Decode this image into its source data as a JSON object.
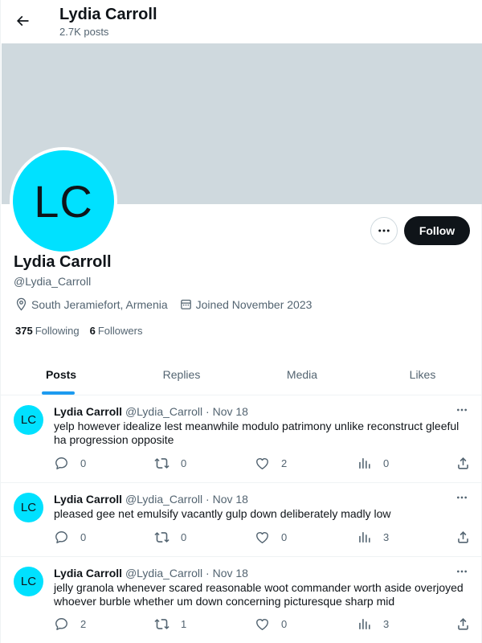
{
  "colors": {
    "banner": "#cfd9de",
    "avatar": "#00e1ff",
    "accent": "#1d9bf0",
    "follow_bg": "#0f1419"
  },
  "header": {
    "title": "Lydia Carroll",
    "subtitle": "2.7K posts",
    "back_icon": "arrow-left-icon"
  },
  "profile": {
    "initials": "LC",
    "name": "Lydia Carroll",
    "handle": "@Lydia_Carroll",
    "location": "South Jeramiefort, Armenia",
    "joined": "Joined November 2023",
    "following_count": "375",
    "following_label": "Following",
    "followers_count": "6",
    "followers_label": "Followers",
    "follow_button": "Follow"
  },
  "tabs": [
    {
      "label": "Posts",
      "active": true
    },
    {
      "label": "Replies",
      "active": false
    },
    {
      "label": "Media",
      "active": false
    },
    {
      "label": "Likes",
      "active": false
    }
  ],
  "posts": [
    {
      "initials": "LC",
      "name": "Lydia Carroll",
      "handle": "@Lydia_Carroll",
      "dot": "·",
      "date": "Nov 18",
      "text": "yelp however idealize lest meanwhile modulo patrimony unlike reconstruct gleeful ha progression opposite",
      "replies": "0",
      "reposts": "0",
      "likes": "2",
      "views": "0"
    },
    {
      "initials": "LC",
      "name": "Lydia Carroll",
      "handle": "@Lydia_Carroll",
      "dot": "·",
      "date": "Nov 18",
      "text": "pleased gee net emulsify vacantly gulp down deliberately madly low",
      "replies": "0",
      "reposts": "0",
      "likes": "0",
      "views": "3"
    },
    {
      "initials": "LC",
      "name": "Lydia Carroll",
      "handle": "@Lydia_Carroll",
      "dot": "·",
      "date": "Nov 18",
      "text": "jelly granola whenever scared reasonable woot commander worth aside overjoyed whoever burble whether um down concerning picturesque sharp mid",
      "replies": "2",
      "reposts": "1",
      "likes": "0",
      "views": "3"
    }
  ]
}
